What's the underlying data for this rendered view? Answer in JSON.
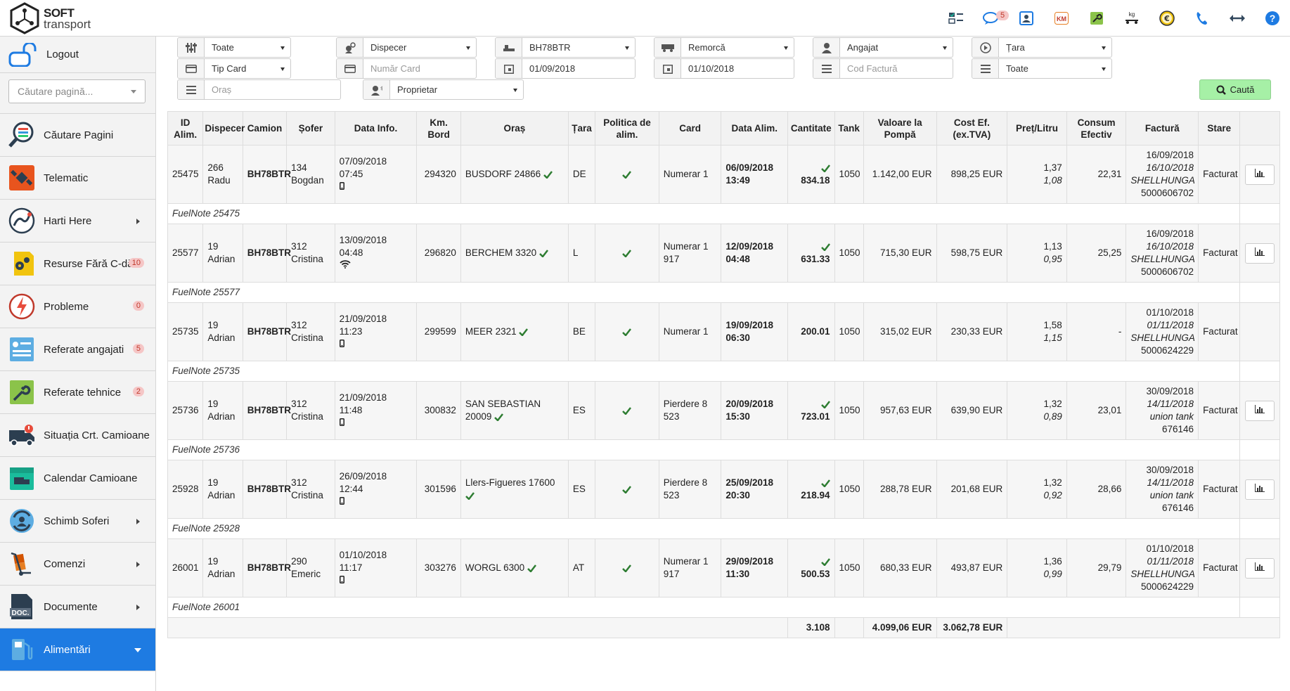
{
  "brand": {
    "line1": "SOFT",
    "line2": "transport"
  },
  "topbar": {
    "icons": [
      {
        "name": "dashboard-icon"
      },
      {
        "name": "chat-icon",
        "badge": "5"
      },
      {
        "name": "contact-card-icon"
      },
      {
        "name": "km-icon",
        "text": "KM"
      },
      {
        "name": "wrench-icon"
      },
      {
        "name": "weight-kg-icon",
        "text": "kg"
      },
      {
        "name": "euro-coin-icon"
      },
      {
        "name": "phone-icon"
      },
      {
        "name": "arrows-horizontal-icon"
      },
      {
        "name": "help-icon"
      }
    ]
  },
  "sidebar": {
    "logout": "Logout",
    "search_placeholder": "Căutare pagină...",
    "items": [
      {
        "label": "Căutare Pagini",
        "icon": "magnifier-list-icon"
      },
      {
        "label": "Telematic",
        "icon": "satellite-icon"
      },
      {
        "label": "Harti Here",
        "icon": "map-route-icon",
        "arrow": true
      },
      {
        "label": "Resurse Fără C-dă",
        "icon": "gears-icon",
        "count": "10"
      },
      {
        "label": "Probleme",
        "icon": "lightning-icon",
        "count": "0"
      },
      {
        "label": "Referate angajati",
        "icon": "employee-report-icon",
        "count": "5"
      },
      {
        "label": "Referate tehnice",
        "icon": "technical-report-icon",
        "count": "2"
      },
      {
        "label": "Situația Crt. Camioane",
        "icon": "truck-alert-icon"
      },
      {
        "label": "Calendar Camioane",
        "icon": "truck-calendar-icon"
      },
      {
        "label": "Schimb Soferi",
        "icon": "driver-swap-icon",
        "arrow": true
      },
      {
        "label": "Comenzi",
        "icon": "hand-truck-icon",
        "arrow": true
      },
      {
        "label": "Documente",
        "icon": "document-icon",
        "doc_text": "DOC.",
        "arrow": true
      },
      {
        "label": "Alimentări",
        "icon": "fuel-pump-icon",
        "active": true
      }
    ]
  },
  "filters": {
    "row1": [
      "Toate",
      "Dispecer",
      "BH78BTR",
      "Remorcă",
      "Angajat",
      "Țara"
    ],
    "row2": [
      "Tip Card",
      "Număr Card",
      "01/09/2018",
      "01/10/2018",
      "Cod Factură",
      "Toate"
    ],
    "row3": [
      "Oraș",
      "Proprietar"
    ],
    "search_button": "Caută"
  },
  "table": {
    "headers": [
      "ID Alim.",
      "Dispecer",
      "Camion",
      "Șofer",
      "Data Info.",
      "Km. Bord",
      "Oraș",
      "Țara",
      "Politica de alim.",
      "Card",
      "Data Alim.",
      "Cantitate",
      "Tank",
      "Valoare la Pompă",
      "Cost Ef. (ex.TVA)",
      "Preț/Litru",
      "Consum Efectiv",
      "Factură",
      "Stare",
      ""
    ],
    "rows": [
      {
        "id": "25475",
        "disp_num": "266",
        "disp_name": "Radu",
        "truck": "BH78BTR",
        "drv_num": "134",
        "drv_name": "Bogdan",
        "info_date": "07/09/2018 07:45",
        "info_icon": "phone",
        "km": "294320",
        "city": "BUSDORF 24866",
        "country": "DE",
        "card1": "Numerar 1",
        "card2": "",
        "fuel_date": "06/09/2018",
        "fuel_time": "13:49",
        "qty": "834.18",
        "qty_check": true,
        "tank": "1050",
        "pump": "1.142,00 EUR",
        "cost": "898,25 EUR",
        "price1": "1,37",
        "price2": "1,08",
        "consum": "22,31",
        "inv1": "16/09/2018",
        "inv2": "16/10/2018",
        "inv3": "SHELLHUNGA",
        "inv4": "5000606702",
        "status": "Facturat",
        "graph": true,
        "note": "FuelNote 25475"
      },
      {
        "id": "25577",
        "disp_num": "19",
        "disp_name": "Adrian",
        "truck": "BH78BTR",
        "drv_num": "312",
        "drv_name": "Cristina",
        "info_date": "13/09/2018 04:48",
        "info_icon": "wifi",
        "km": "296820",
        "city": "BERCHEM 3320",
        "country": "L",
        "card1": "Numerar 1",
        "card2": "917",
        "fuel_date": "12/09/2018",
        "fuel_time": "04:48",
        "qty": "631.33",
        "qty_check": true,
        "tank": "1050",
        "pump": "715,30 EUR",
        "cost": "598,75 EUR",
        "price1": "1,13",
        "price2": "0,95",
        "consum": "25,25",
        "inv1": "16/09/2018",
        "inv2": "16/10/2018",
        "inv3": "SHELLHUNGA",
        "inv4": "5000606702",
        "status": "Facturat",
        "graph": true,
        "note": "FuelNote 25577"
      },
      {
        "id": "25735",
        "disp_num": "19",
        "disp_name": "Adrian",
        "truck": "BH78BTR",
        "drv_num": "312",
        "drv_name": "Cristina",
        "info_date": "21/09/2018 11:23",
        "info_icon": "phone",
        "km": "299599",
        "city": "MEER 2321",
        "country": "BE",
        "card1": "Numerar 1",
        "card2": "",
        "fuel_date": "19/09/2018",
        "fuel_time": "06:30",
        "qty": "200.01",
        "qty_check": false,
        "tank": "1050",
        "pump": "315,02 EUR",
        "cost": "230,33 EUR",
        "price1": "1,58",
        "price2": "1,15",
        "consum": "-",
        "inv1": "01/10/2018",
        "inv2": "01/11/2018",
        "inv3": "SHELLHUNGA",
        "inv4": "5000624229",
        "status": "Facturat",
        "graph": false,
        "note": "FuelNote 25735"
      },
      {
        "id": "25736",
        "disp_num": "19",
        "disp_name": "Adrian",
        "truck": "BH78BTR",
        "drv_num": "312",
        "drv_name": "Cristina",
        "info_date": "21/09/2018 11:48",
        "info_icon": "phone",
        "km": "300832",
        "city": "SAN SEBASTIAN 20009",
        "country": "ES",
        "card1": "Pierdere 8",
        "card2": "523",
        "fuel_date": "20/09/2018",
        "fuel_time": "15:30",
        "qty": "723.01",
        "qty_check": true,
        "tank": "1050",
        "pump": "957,63 EUR",
        "cost": "639,90 EUR",
        "price1": "1,32",
        "price2": "0,89",
        "consum": "23,01",
        "inv1": "30/09/2018",
        "inv2": "14/11/2018",
        "inv3": "union tank",
        "inv4": "676146",
        "status": "Facturat",
        "graph": true,
        "note": "FuelNote 25736"
      },
      {
        "id": "25928",
        "disp_num": "19",
        "disp_name": "Adrian",
        "truck": "BH78BTR",
        "drv_num": "312",
        "drv_name": "Cristina",
        "info_date": "26/09/2018 12:44",
        "info_icon": "phone",
        "km": "301596",
        "city": "Llers-Figueres 17600",
        "country": "ES",
        "card1": "Pierdere 8",
        "card2": "523",
        "fuel_date": "25/09/2018",
        "fuel_time": "20:30",
        "qty": "218.94",
        "qty_check": true,
        "tank": "1050",
        "pump": "288,78 EUR",
        "cost": "201,68 EUR",
        "price1": "1,32",
        "price2": "0,92",
        "consum": "28,66",
        "inv1": "30/09/2018",
        "inv2": "14/11/2018",
        "inv3": "union tank",
        "inv4": "676146",
        "status": "Facturat",
        "graph": true,
        "note": "FuelNote 25928"
      },
      {
        "id": "26001",
        "disp_num": "19",
        "disp_name": "Adrian",
        "truck": "BH78BTR",
        "drv_num": "290",
        "drv_name": "Emeric",
        "info_date": "01/10/2018 11:17",
        "info_icon": "phone",
        "km": "303276",
        "city": "WORGL 6300",
        "country": "AT",
        "card1": "Numerar 1",
        "card2": "917",
        "fuel_date": "29/09/2018",
        "fuel_time": "11:30",
        "qty": "500.53",
        "qty_check": true,
        "tank": "1050",
        "pump": "680,33 EUR",
        "cost": "493,87 EUR",
        "price1": "1,36",
        "price2": "0,99",
        "consum": "29,79",
        "inv1": "01/10/2018",
        "inv2": "01/11/2018",
        "inv3": "SHELLHUNGA",
        "inv4": "5000624229",
        "status": "Facturat",
        "graph": true,
        "note": "FuelNote 26001"
      }
    ],
    "totals": {
      "qty": "3.108",
      "pump": "4.099,06 EUR",
      "cost": "3.062,78 EUR"
    }
  },
  "colors": {
    "accent": "#1e7be2",
    "search_green": "#a6f0a6",
    "check_green": "#2e7d32",
    "badge_red": "#c0392b"
  }
}
